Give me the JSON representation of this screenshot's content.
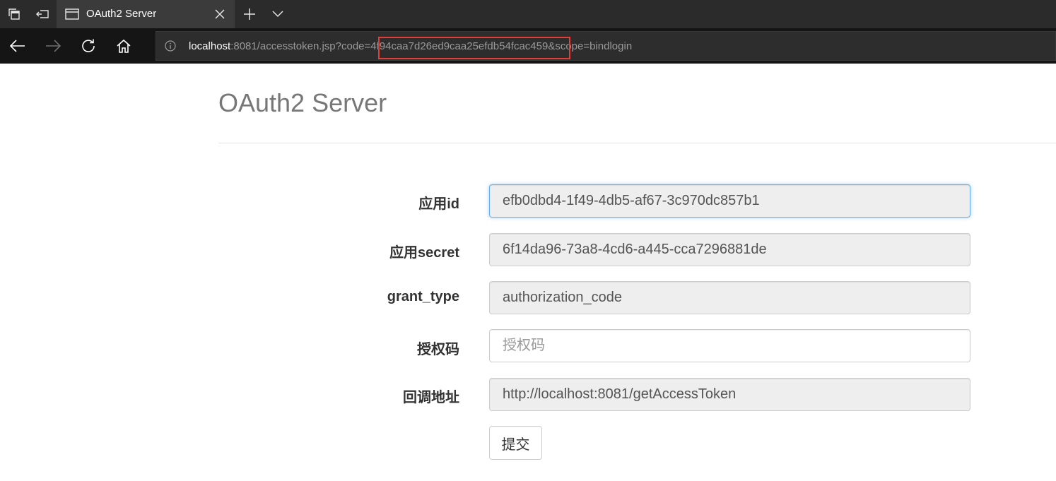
{
  "browser": {
    "tab_title": "OAuth2 Server",
    "url": {
      "host": "localhost",
      "path_before_code": ":8081/accesstoken.jsp?code=",
      "code": "4f94caa7d26ed9caa25efdb54fcac459",
      "path_after_code": "&scope=bindlogin"
    },
    "highlight_color": "#e0403c"
  },
  "page": {
    "title": "OAuth2 Server"
  },
  "form": {
    "fields": [
      {
        "label": "应用id",
        "value": "efb0dbd4-1f49-4db5-af67-3c970dc857b1",
        "placeholder": "",
        "readonly": true,
        "focused": true
      },
      {
        "label": "应用secret",
        "value": "6f14da96-73a8-4cd6-a445-cca7296881de",
        "placeholder": "",
        "readonly": true
      },
      {
        "label": "grant_type",
        "value": "authorization_code",
        "placeholder": "",
        "readonly": true
      },
      {
        "label": "授权码",
        "value": "",
        "placeholder": "授权码",
        "readonly": false
      },
      {
        "label": "回调地址",
        "value": "http://localhost:8081/getAccessToken",
        "placeholder": "",
        "readonly": true
      }
    ],
    "submit_label": "提交"
  },
  "colors": {
    "chrome_dark": "#2b2b2b",
    "address_bar": "#151515",
    "focus_border": "#66afe9"
  }
}
